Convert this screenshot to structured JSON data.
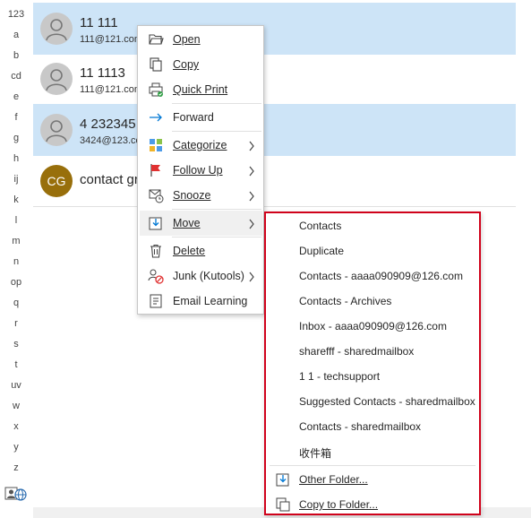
{
  "alphabet_index": [
    "123",
    "a",
    "b",
    "cd",
    "e",
    "f",
    "g",
    "h",
    "ij",
    "k",
    "l",
    "m",
    "n",
    "op",
    "q",
    "r",
    "s",
    "t",
    "uv",
    "w",
    "x",
    "y",
    "z"
  ],
  "contacts": [
    {
      "name": "11 111",
      "email": "111@121.com",
      "selected": true,
      "avatar": "person"
    },
    {
      "name": "11 1113",
      "email": "111@121.com",
      "selected": false,
      "avatar": "person"
    },
    {
      "name": "4 232345",
      "email": "3424@123.com",
      "selected": true,
      "avatar": "person"
    },
    {
      "name": "contact group",
      "email": "",
      "selected": false,
      "avatar": "initials",
      "initials": "CG",
      "avatar_color": "#986f0b"
    }
  ],
  "context_menu": {
    "items": [
      {
        "label": "Open",
        "icon": "open-folder-icon"
      },
      {
        "label": "Copy",
        "icon": "copy-icon"
      },
      {
        "label": "Quick Print",
        "icon": "quick-print-icon"
      },
      {
        "label": "Forward",
        "icon": "forward-arrow-icon"
      },
      {
        "label": "Categorize",
        "icon": "categorize-icon",
        "submenu": true
      },
      {
        "label": "Follow Up",
        "icon": "flag-icon",
        "submenu": true
      },
      {
        "label": "Snooze",
        "icon": "snooze-icon",
        "submenu": true
      },
      {
        "label": "Move",
        "icon": "move-icon",
        "submenu": true,
        "active": true
      },
      {
        "label": "Delete",
        "icon": "trash-icon"
      },
      {
        "label": "Junk (Kutools)",
        "icon": "junk-icon",
        "submenu": true
      },
      {
        "label": "Email Learning",
        "icon": "email-learning-icon"
      }
    ]
  },
  "move_submenu": {
    "folders": [
      "Contacts",
      "Duplicate",
      "Contacts - aaaa090909@126.com",
      "Contacts - Archives",
      "Inbox - aaaa090909@126.com",
      "sharefff - sharedmailbox",
      "1 1 - techsupport",
      "Suggested Contacts - sharedmailbox",
      "Contacts - sharedmailbox",
      "收件箱"
    ],
    "other_folder": "Other Folder...",
    "copy_to_folder": "Copy to Folder..."
  },
  "colors": {
    "selection": "#cde4f7",
    "highlight_border": "#d0021b",
    "accent": "#0078d4"
  }
}
